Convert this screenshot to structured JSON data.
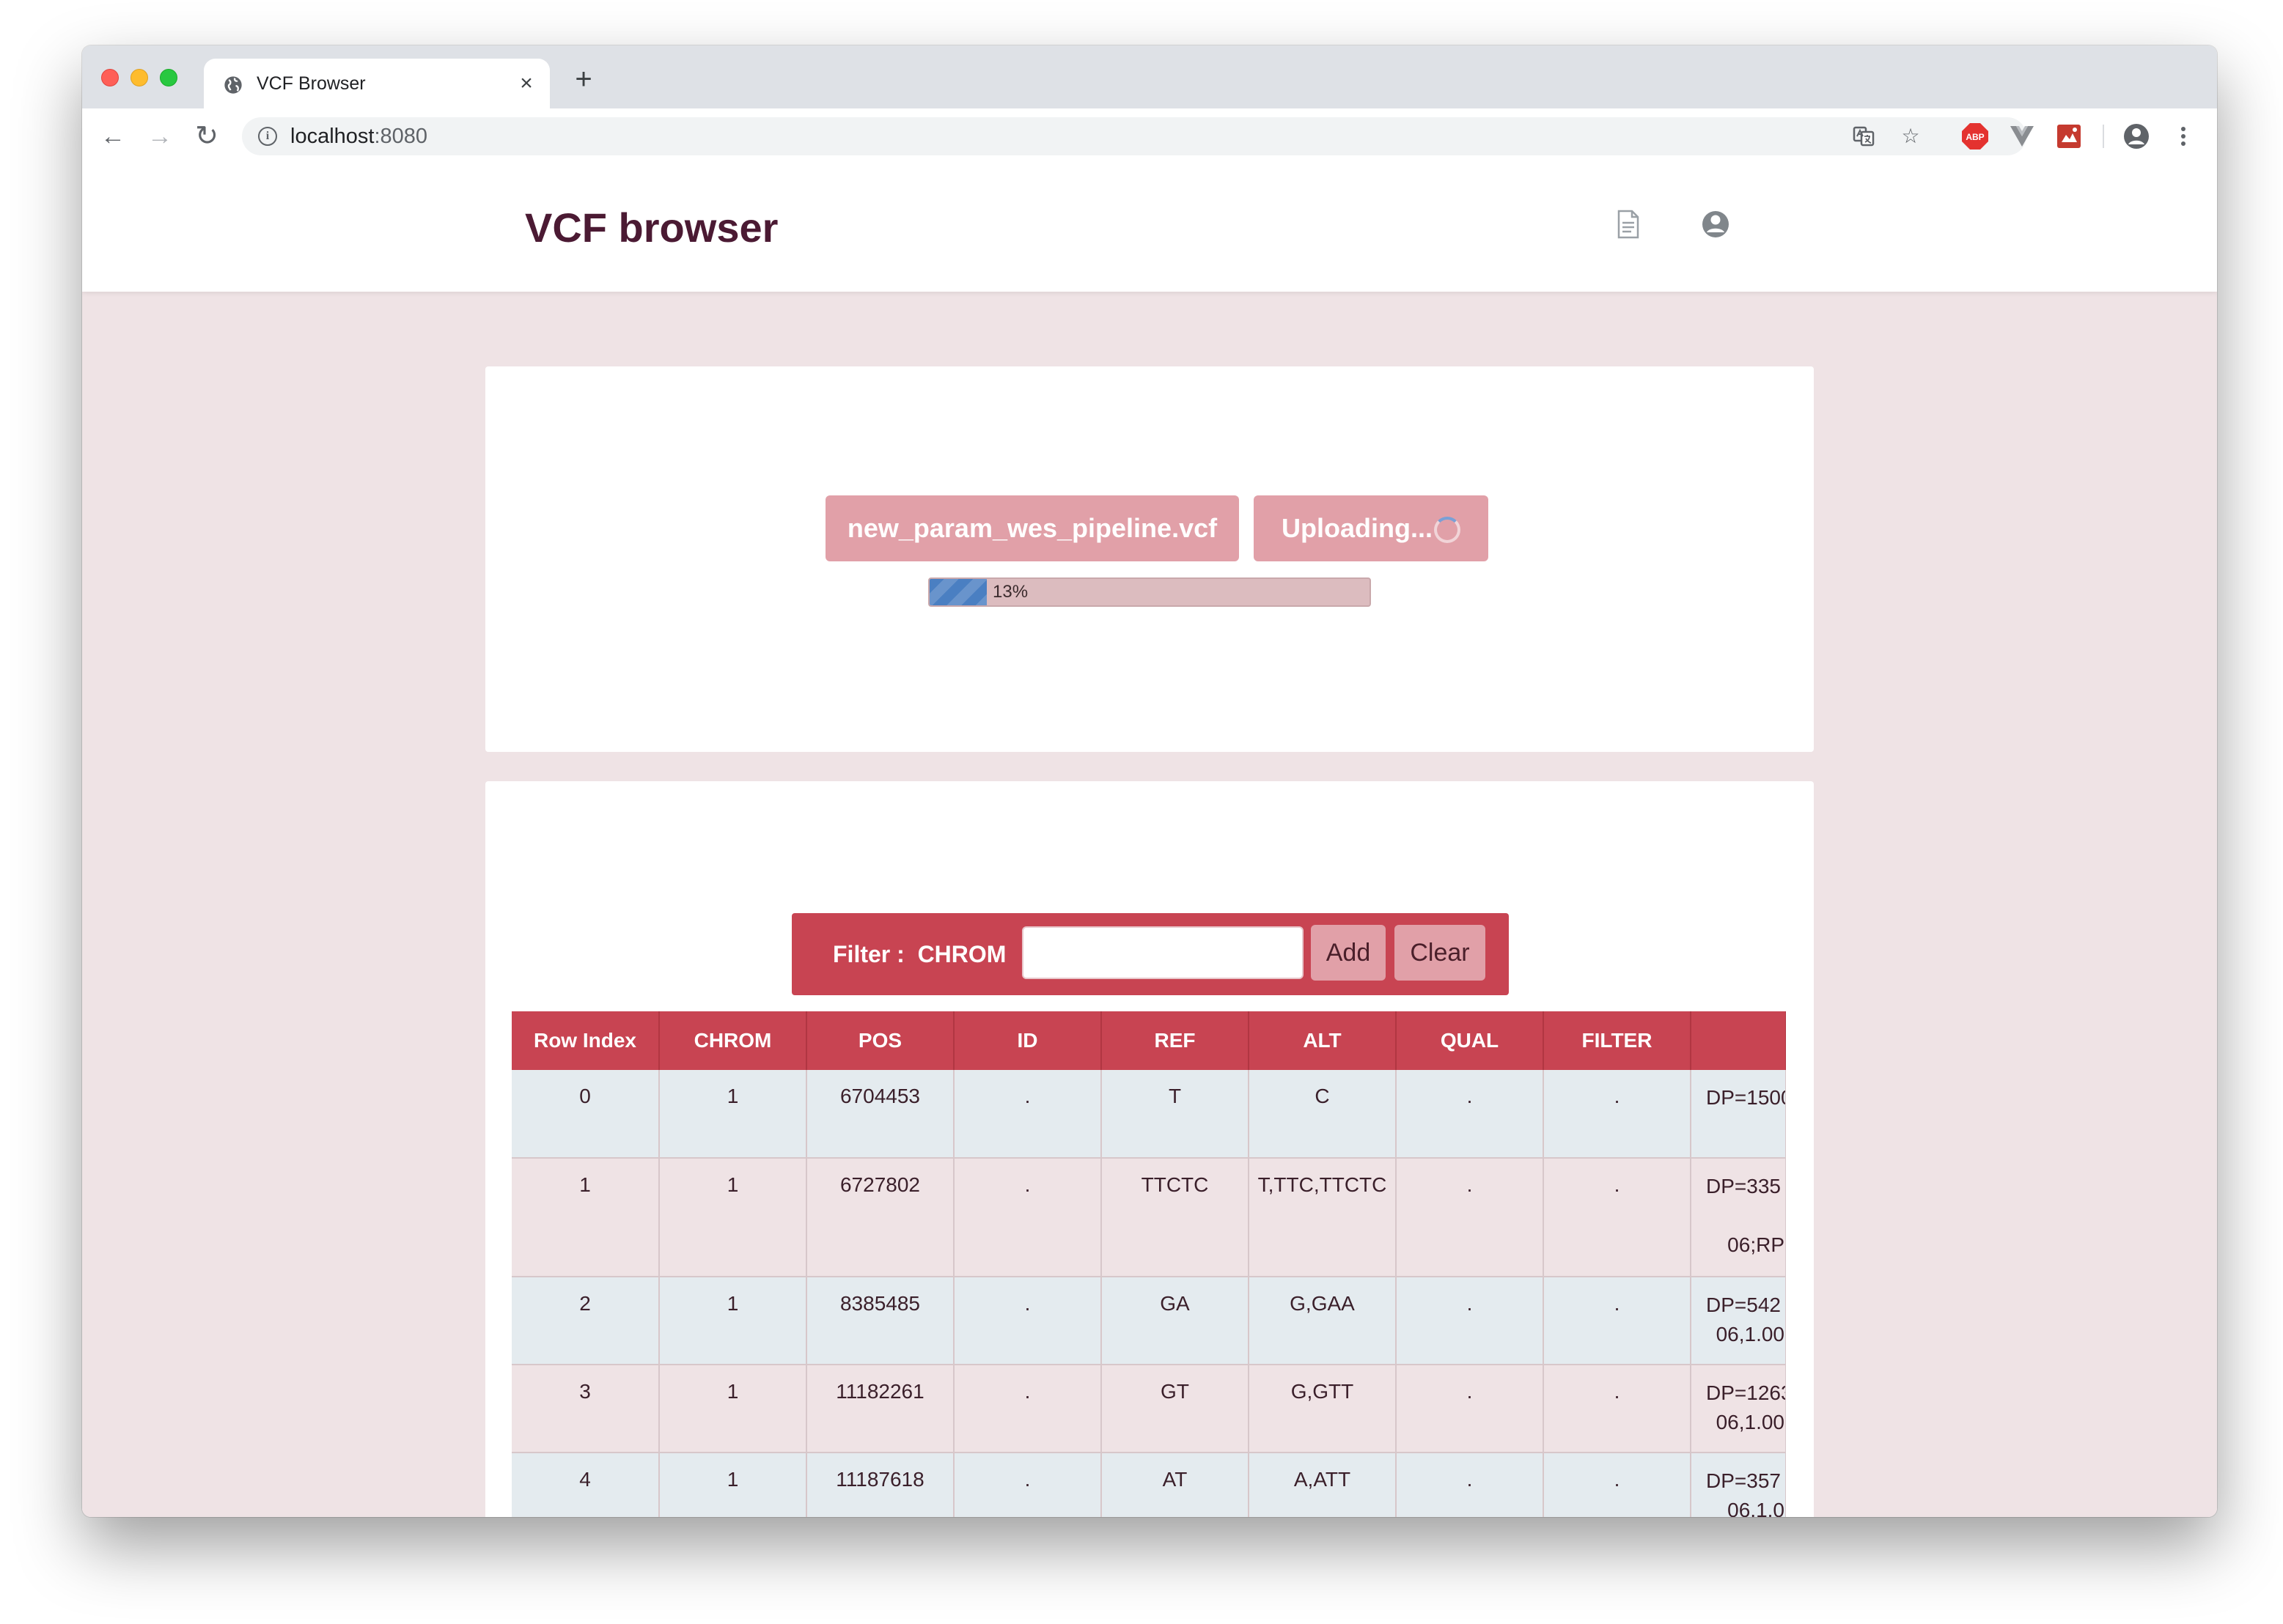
{
  "browser": {
    "tab_title": "VCF Browser",
    "tab_close": "×",
    "new_tab": "+",
    "url_host": "localhost",
    "url_port": ":8080"
  },
  "app": {
    "title": "VCF browser"
  },
  "upload": {
    "file_name": "new_param_wes_pipeline.vcf",
    "status": "Uploading...",
    "progress_percent": 13,
    "progress_label": "13%"
  },
  "filter": {
    "label": "Filter :  CHROM",
    "input_value": "",
    "add_label": "Add",
    "clear_label": "Clear"
  },
  "table": {
    "columns": [
      "Row Index",
      "CHROM",
      "POS",
      "ID",
      "REF",
      "ALT",
      "QUAL",
      "FILTER",
      ""
    ],
    "rows": [
      {
        "idx": "0",
        "chrom": "1",
        "pos": "6704453",
        "id": ".",
        "ref": "T",
        "alt": "C",
        "qual": ".",
        "filter": ".",
        "info1": "DP=1500",
        "info2": ""
      },
      {
        "idx": "1",
        "chrom": "1",
        "pos": "6727802",
        "id": ".",
        "ref": "TTCTC",
        "alt": "T,TTC,TTCTC",
        "qual": ".",
        "filter": ".",
        "info1": "DP=335",
        "info2": "06;RP"
      },
      {
        "idx": "2",
        "chrom": "1",
        "pos": "8385485",
        "id": ".",
        "ref": "GA",
        "alt": "G,GAA",
        "qual": ".",
        "filter": ".",
        "info1": "DP=542",
        "info2": "06,1.00"
      },
      {
        "idx": "3",
        "chrom": "1",
        "pos": "11182261",
        "id": ".",
        "ref": "GT",
        "alt": "G,GTT",
        "qual": ".",
        "filter": ".",
        "info1": "DP=1263",
        "info2": "06,1.00"
      },
      {
        "idx": "4",
        "chrom": "1",
        "pos": "11187618",
        "id": ".",
        "ref": "AT",
        "alt": "A,ATT",
        "qual": ".",
        "filter": ".",
        "info1": "DP=357",
        "info2": "06,1.0"
      }
    ]
  },
  "colors": {
    "accent": "#c84452",
    "accent_light": "#e1a0a8",
    "brand_text": "#4b1a33",
    "page_bg": "#efe3e5",
    "row_alt": "#e4ebef",
    "progress_fill": "#4a7fc2"
  },
  "icons": {
    "tab_favicon": "globe-icon",
    "back": "arrow-left-icon",
    "forward": "arrow-right-icon",
    "reload": "reload-icon",
    "info": "info-icon",
    "translate": "translate-icon",
    "bookmark": "star-icon",
    "adblock": "adblock-icon",
    "vue_devtools": "vue-icon",
    "extension": "extension-icon",
    "profile": "profile-icon",
    "menu": "menu-icon",
    "document": "document-icon",
    "account": "account-icon"
  }
}
